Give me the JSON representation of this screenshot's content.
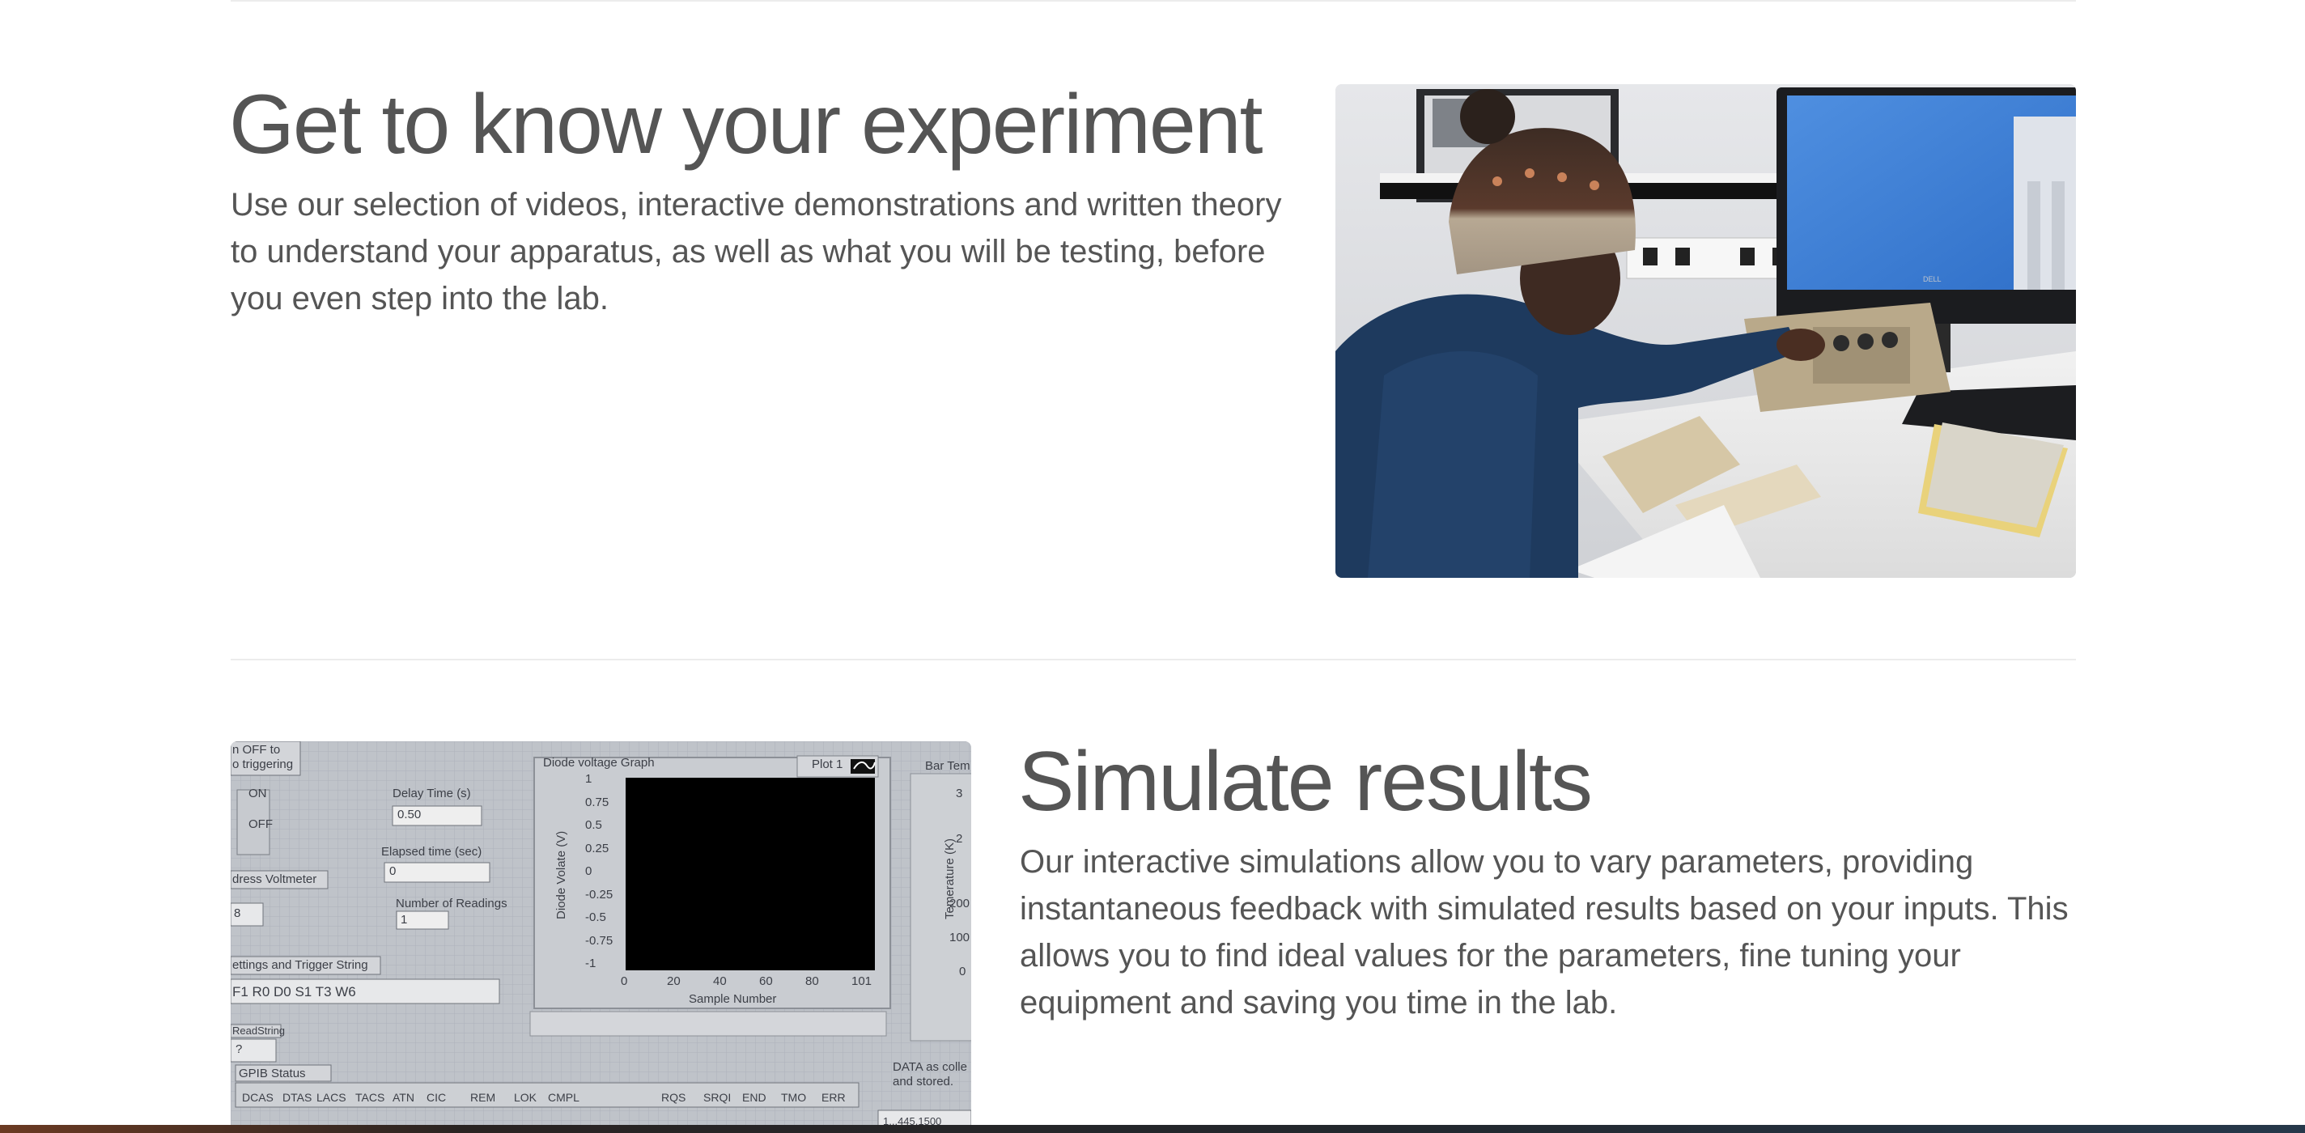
{
  "section_experiment": {
    "heading": "Get to know your experiment",
    "description": "Use our selection of videos, interactive demonstrations and written theory to understand your apparatus, as well as what you will be testing, before you even step into the lab.",
    "image_monitor_brand": "DELL"
  },
  "section_simulate": {
    "heading": "Simulate results",
    "description": "Our interactive simulations allow you to vary parameters, providing instantaneous feedback with simulated results based on your inputs. This allows you to find ideal values for the parameters, fine tuning your equipment and saving you time in the lab.",
    "screenshot": {
      "triggering_label_1": "n OFF to",
      "triggering_label_2": "o triggering",
      "switch_on": "ON",
      "switch_off": "OFF",
      "delay_time_label": "Delay Time (s)",
      "delay_time_value": "0.50",
      "elapsed_time_label": "Elapsed time (sec)",
      "elapsed_time_value": "0",
      "address_label": "dress Voltmeter",
      "address_value": "8",
      "num_readings_label": "Number of Readings",
      "num_readings_value": "1",
      "settings_label": "ettings and Trigger String",
      "settings_value": "F1 R0 D0 S1 T3 W6",
      "readstring_label": "ReadString",
      "readstring_value": "?",
      "gpib_label": "GPIB Status",
      "graph_title": "Diode voltage Graph",
      "plot_legend": "Plot 1",
      "y_axis_label": "Diode Volate (V)",
      "x_axis_label": "Sample Number",
      "y_ticks": [
        "1",
        "0.75",
        "0.5",
        "0.25",
        "0",
        "-0.25",
        "-0.5",
        "-0.75",
        "-1"
      ],
      "x_ticks": [
        "0",
        "20",
        "40",
        "60",
        "80",
        "101"
      ],
      "bar_temp_label": "Bar Tem",
      "temp_axis_label": "Temerature (K)",
      "temp_ticks": [
        "3",
        "2",
        "200",
        "100",
        "0"
      ],
      "status_bits": [
        "DCAS",
        "DTAS",
        "LACS",
        "TACS",
        "ATN",
        "CIC",
        "REM",
        "LOK",
        "CMPL",
        "RQS",
        "SRQI",
        "END",
        "TMO",
        "ERR"
      ],
      "data_note_1": "DATA as colle",
      "data_note_2": "and stored.",
      "data_value": "1...445.1500"
    }
  }
}
